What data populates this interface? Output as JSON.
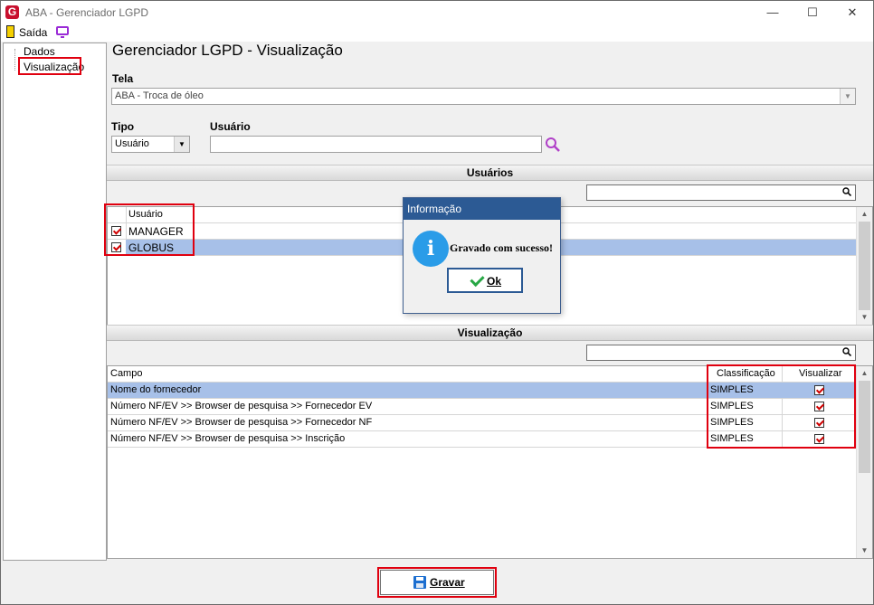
{
  "window": {
    "title": "ABA - Gerenciador LGPD",
    "minimize": "—",
    "maximize": "☐",
    "close": "✕"
  },
  "toolbar": {
    "exit_label": "Saída",
    "logo_letter": "G"
  },
  "tree": {
    "items": [
      {
        "label": "Dados"
      },
      {
        "label": "Visualização"
      }
    ]
  },
  "page": {
    "title": "Gerenciador LGPD - Visualização"
  },
  "tela": {
    "label": "Tela",
    "value": "ABA - Troca de óleo"
  },
  "tipo": {
    "label": "Tipo",
    "value": "Usuário"
  },
  "usuario": {
    "label": "Usuário",
    "value": ""
  },
  "users_section": {
    "title": "Usuários",
    "column": "Usuário",
    "rows": [
      {
        "name": "MANAGER",
        "checked": true
      },
      {
        "name": "GLOBUS",
        "checked": true,
        "selected": true
      }
    ]
  },
  "view_section": {
    "title": "Visualização",
    "columns": {
      "campo": "Campo",
      "classificacao": "Classificação",
      "visualizar": "Visualizar"
    },
    "rows": [
      {
        "campo": "Nome do fornecedor",
        "classificacao": "SIMPLES",
        "visualizar": true,
        "selected": true
      },
      {
        "campo": "Número NF/EV >> Browser de pesquisa >> Fornecedor EV",
        "classificacao": "SIMPLES",
        "visualizar": true
      },
      {
        "campo": "Número NF/EV >> Browser de pesquisa >> Fornecedor NF",
        "classificacao": "SIMPLES",
        "visualizar": true
      },
      {
        "campo": "Número NF/EV >> Browser de pesquisa >> Inscrição",
        "classificacao": "SIMPLES",
        "visualizar": true
      }
    ]
  },
  "dialog": {
    "title": "Informação",
    "message": "Gravado com sucesso!",
    "ok_label": "Ok",
    "icon_letter": "i"
  },
  "footer": {
    "save_label": "Gravar"
  },
  "colors": {
    "accent": "#2c5a94",
    "selection": "#a7c0e8",
    "highlight": "#e0000f"
  }
}
